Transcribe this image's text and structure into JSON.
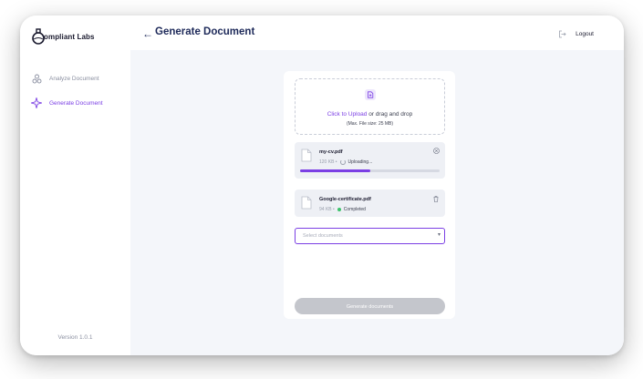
{
  "app": {
    "brand": "Compliant Labs",
    "brand_initial": "C",
    "brand_rest": "ompliant Labs",
    "version": "Version 1.0.1"
  },
  "sidebar": {
    "items": [
      {
        "label": "Analyze Document",
        "active": false
      },
      {
        "label": "Generate Document",
        "active": true
      }
    ]
  },
  "header": {
    "title": "Generate Document",
    "logout_label": "Logout"
  },
  "upload": {
    "link_text": "Click to Upload",
    "rest_text": " or drag and drop",
    "hint": "(Max. File size: 25 MB)"
  },
  "files": [
    {
      "name": "my-cv.pdf",
      "size": "120 KB",
      "status": "Uploading...",
      "progress": 0.5
    },
    {
      "name": "Google-certificate.pdf",
      "size": "94 KB",
      "status": "Completed"
    }
  ],
  "select": {
    "placeholder": "Select documents"
  },
  "generate_button": "Generate documents",
  "colors": {
    "accent": "#7b3fe4",
    "title": "#1e2a5a",
    "success": "#3cc26b",
    "disabled_button": "#c4c6cc"
  }
}
